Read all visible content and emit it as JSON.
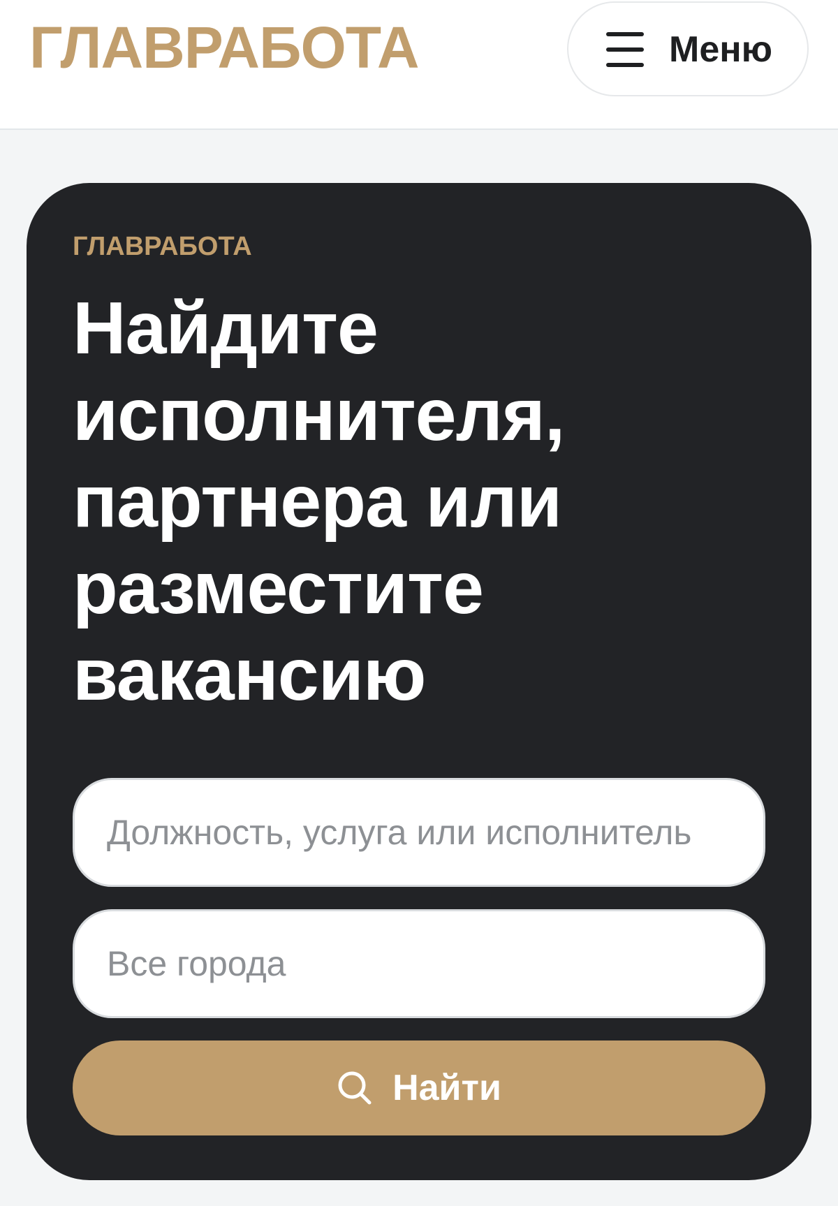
{
  "header": {
    "logo": "ГЛАВРАБОТА",
    "menu_label": "Меню"
  },
  "hero": {
    "eyebrow": "ГЛАВРАБОТА",
    "title": "Найдите исполнителя, партнера или разместите вакансию"
  },
  "search": {
    "position_placeholder": "Должность, услуга или исполнитель",
    "position_value": "",
    "city_placeholder": "Все города",
    "city_value": "",
    "button_label": "Найти"
  },
  "colors": {
    "brand_gold": "#c19e6d",
    "card_dark": "#222326",
    "page_background": "#f3f5f6"
  },
  "icons": {
    "menu": "hamburger-menu-icon",
    "search": "search-icon"
  }
}
